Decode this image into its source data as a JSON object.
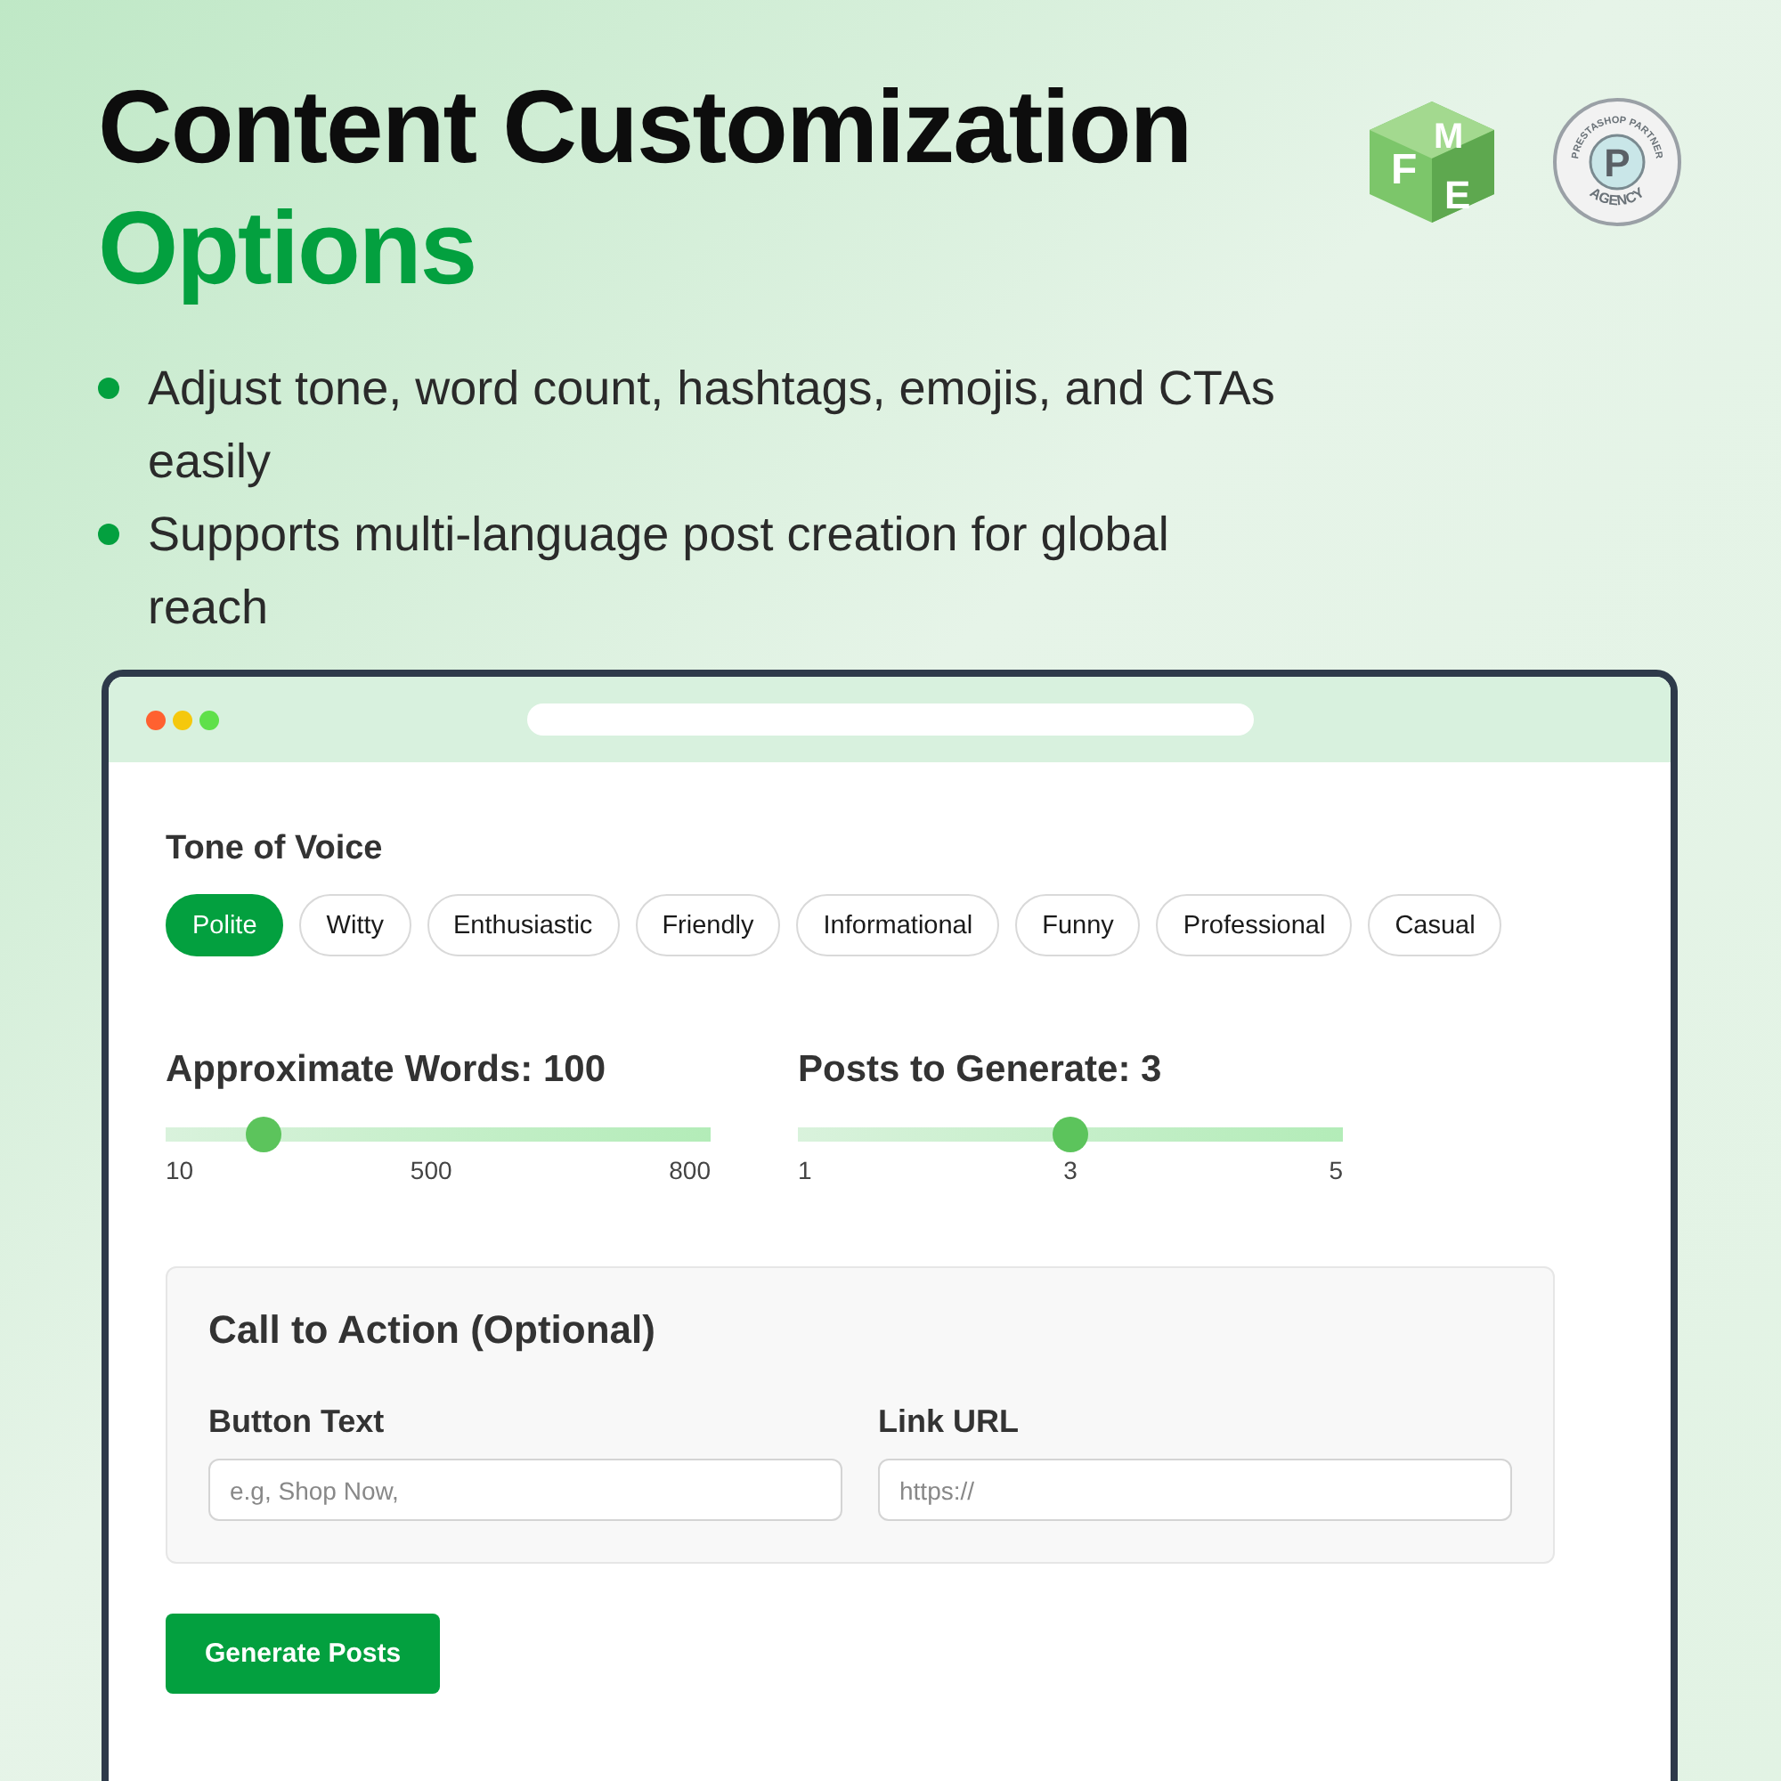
{
  "header": {
    "title": "Content Customization",
    "highlight": "Options"
  },
  "logos": {
    "cube_letters": [
      "F",
      "M",
      "E"
    ],
    "badge_top": "PRESTASHOP PARTNER",
    "badge_mark": "P",
    "badge_bottom": "AGENCY"
  },
  "bullets": [
    "Adjust tone, word count, hashtags, emojis, and CTAs easily",
    "Supports multi-language post creation for global reach"
  ],
  "tone": {
    "label": "Tone of Voice",
    "options": [
      {
        "label": "Polite",
        "selected": true
      },
      {
        "label": "Witty",
        "selected": false
      },
      {
        "label": "Enthusiastic",
        "selected": false
      },
      {
        "label": "Friendly",
        "selected": false
      },
      {
        "label": "Informational",
        "selected": false
      },
      {
        "label": "Funny",
        "selected": false
      },
      {
        "label": "Professional",
        "selected": false
      },
      {
        "label": "Casual",
        "selected": false
      }
    ]
  },
  "sliders": [
    {
      "label": "Approximate Words: 100",
      "level": 0.18,
      "ticks": [
        "10",
        "500",
        "800"
      ]
    },
    {
      "label": "Posts to Generate: 3",
      "level": 0.5,
      "ticks": [
        "1",
        "3",
        "5"
      ]
    }
  ],
  "cta": {
    "title": "Call to Action (Optional)",
    "fields": [
      {
        "label": "Button Text",
        "placeholder": "e.g, Shop Now,"
      },
      {
        "label": "Link URL",
        "placeholder": "https://"
      }
    ]
  },
  "button": "Generate Posts"
}
